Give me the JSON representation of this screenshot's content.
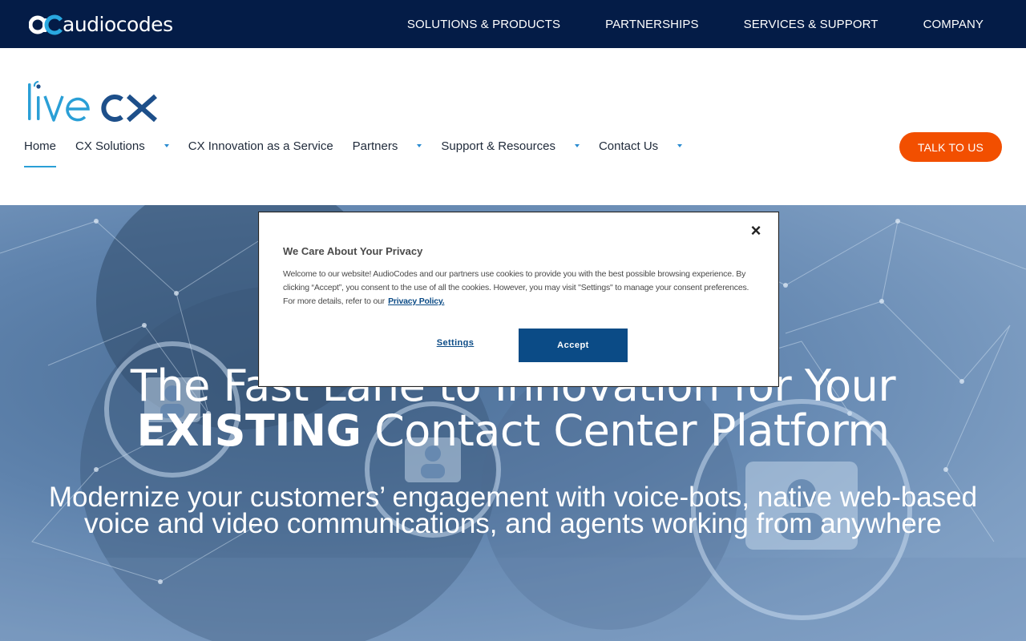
{
  "topbar": {
    "brand_text": "audiocodes",
    "nav": [
      {
        "label": "SOLUTIONS & PRODUCTS"
      },
      {
        "label": "PARTNERSHIPS"
      },
      {
        "label": "SERVICES & SUPPORT"
      },
      {
        "label": "COMPANY"
      }
    ]
  },
  "subheader": {
    "logo_text": "livecx",
    "nav": [
      {
        "label": "Home",
        "active": true,
        "has_dropdown": false
      },
      {
        "label": "CX Solutions",
        "active": false,
        "has_dropdown": true
      },
      {
        "label": "CX Innovation as a Service",
        "active": false,
        "has_dropdown": false
      },
      {
        "label": "Partners",
        "active": false,
        "has_dropdown": true
      },
      {
        "label": "Support & Resources",
        "active": false,
        "has_dropdown": true
      },
      {
        "label": "Contact Us",
        "active": false,
        "has_dropdown": true
      }
    ],
    "cta_label": "TALK TO US"
  },
  "hero": {
    "title_line1": "The Fast Lane to Innovation for Your",
    "title_bold": "EXISTING",
    "title_line2_rest": " Contact Center Platform",
    "subtitle": "Modernize your customers’ engagement with voice-bots, native web-based voice and video communications, and agents working from anywhere"
  },
  "cookie_modal": {
    "close_symbol": "×",
    "title": "We Care About Your Privacy",
    "body": "Welcome to our website! AudioCodes and our partners use cookies to provide you with the best possible browsing experience. By clicking “Accept”, you consent to the use of all the cookies. However, you may visit \"Settings\" to manage your consent preferences. For more details, refer to our",
    "policy_link": "Privacy Policy.",
    "settings_label": "Settings",
    "accept_label": "Accept"
  },
  "colors": {
    "topbar_bg": "#041c47",
    "cta_orange": "#f24f00",
    "accept_blue": "#0b4b86",
    "active_underline": "#2a9fd6"
  }
}
